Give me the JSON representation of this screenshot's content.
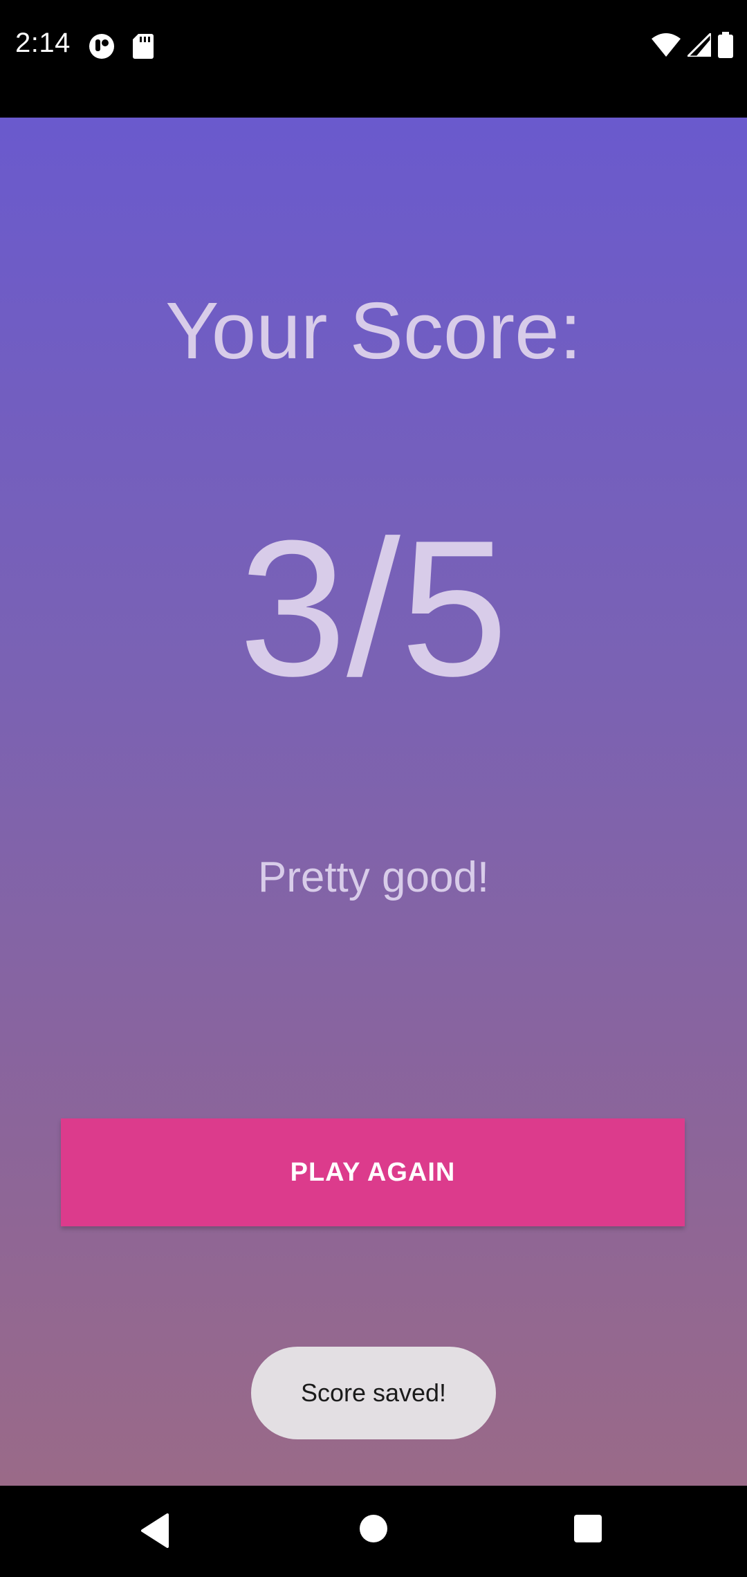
{
  "status_bar": {
    "time": "2:14",
    "icons_left": [
      "app-notification-icon",
      "sd-card-icon"
    ],
    "icons_right": [
      "wifi-icon",
      "cellular-signal-icon",
      "battery-icon"
    ]
  },
  "result": {
    "title": "Your Score:",
    "score": "3/5",
    "message": "Pretty good!"
  },
  "actions": {
    "play_again_label": "PLAY AGAIN"
  },
  "toast": {
    "text": "Score saved!"
  },
  "navigation": {
    "buttons": [
      "back",
      "home",
      "recents"
    ]
  },
  "colors": {
    "gradient_top": "#6a5acd",
    "gradient_bottom": "#9a6a88",
    "text": "#d8cce9",
    "button": "#dc3b8c",
    "toast_bg": "#e3dfe3"
  }
}
